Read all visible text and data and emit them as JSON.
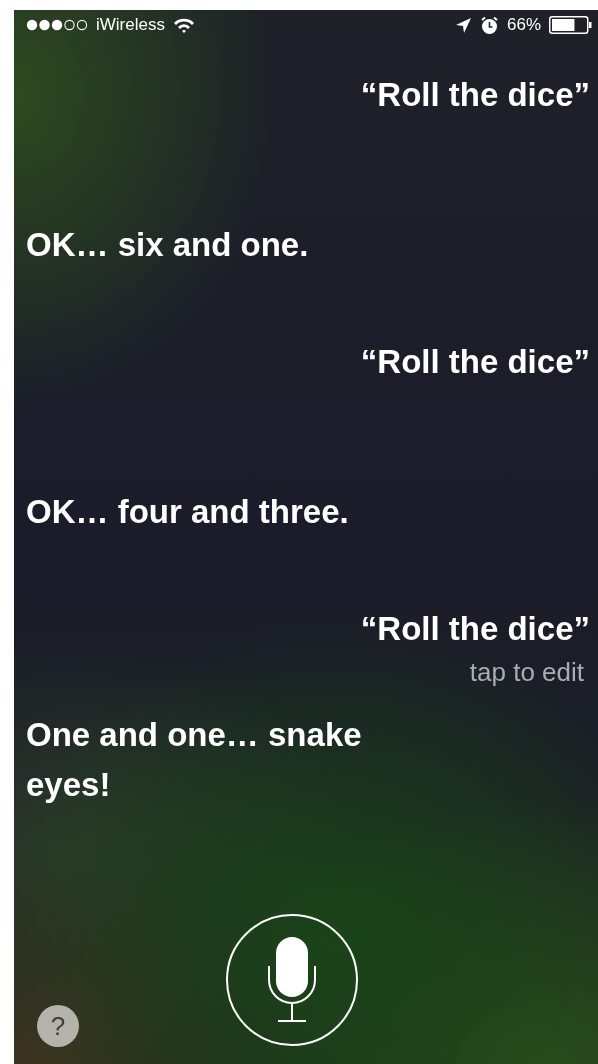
{
  "status_bar": {
    "carrier": "iWireless",
    "battery_percent": "66%",
    "battery": {
      "level": 0.66
    }
  },
  "conversation": [
    {
      "kind": "user",
      "text": "“Roll the dice”"
    },
    {
      "kind": "siri",
      "text": "OK… six and one."
    },
    {
      "kind": "user",
      "text": "“Roll the dice”"
    },
    {
      "kind": "siri",
      "text": "OK… four and three."
    },
    {
      "kind": "user",
      "text": "“Roll the dice”",
      "hint": "tap to edit"
    },
    {
      "kind": "siri",
      "text": "One and one… snake eyes!"
    }
  ],
  "help_button": {
    "label": "?"
  }
}
